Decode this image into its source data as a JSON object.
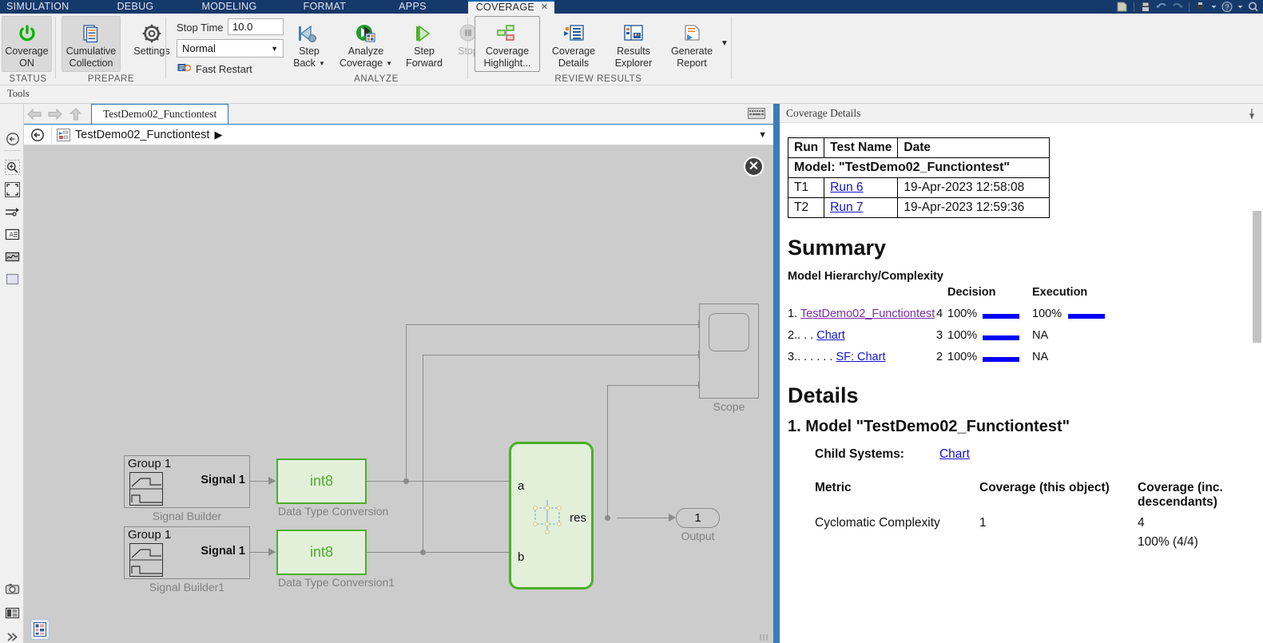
{
  "ribbon": {
    "tabs": [
      {
        "label": "SIMULATION",
        "active": false
      },
      {
        "label": "DEBUG",
        "active": false
      },
      {
        "label": "MODELING",
        "active": false
      },
      {
        "label": "FORMAT",
        "active": false
      },
      {
        "label": "APPS",
        "active": false
      },
      {
        "label": "COVERAGE",
        "active": true
      }
    ],
    "groups": {
      "status": {
        "caption": "STATUS",
        "coverage_toggle": {
          "line1": "Coverage",
          "line2": "ON",
          "icon": "power-icon"
        }
      },
      "prepare": {
        "caption": "PREPARE",
        "cumulative": {
          "line1": "Cumulative",
          "line2": "Collection",
          "icon": "documents-icon"
        },
        "settings": {
          "label": "Settings",
          "icon": "gear-icon"
        }
      },
      "analyze": {
        "caption": "ANALYZE",
        "stop_time_label": "Stop Time",
        "stop_time_value": "10.0",
        "sim_mode_value": "Normal",
        "fast_restart_label": "Fast Restart",
        "step_back": {
          "line1": "Step",
          "line2": "Back",
          "icon": "step-back-icon"
        },
        "analyze_coverage": {
          "line1": "Analyze",
          "line2": "Coverage",
          "icon": "run-coverage-icon"
        },
        "step_forward": {
          "line1": "Step",
          "line2": "Forward",
          "icon": "step-forward-icon"
        },
        "stop": {
          "label": "Stop",
          "icon": "stop-icon"
        }
      },
      "review": {
        "caption": "REVIEW RESULTS",
        "coverage_highlight": {
          "line1": "Coverage",
          "line2": "Highlight...",
          "icon": "coverage-highlight-icon"
        },
        "coverage_details": {
          "line1": "Coverage",
          "line2": "Details",
          "icon": "coverage-details-icon"
        },
        "results_explorer": {
          "line1": "Results",
          "line2": "Explorer",
          "icon": "results-explorer-icon"
        },
        "generate_report": {
          "line1": "Generate",
          "line2": "Report",
          "icon": "generate-report-icon"
        }
      }
    }
  },
  "tools_bar": {
    "label": "Tools"
  },
  "editor": {
    "tab_label": "TestDemo02_Functiontest",
    "breadcrumb_label": "TestDemo02_Functiontest"
  },
  "canvas": {
    "blocks": [
      {
        "name": "Signal Builder",
        "group": "Group 1",
        "signal": "Signal 1"
      },
      {
        "name": "Signal Builder1",
        "group": "Group 1",
        "signal": "Signal 1"
      },
      {
        "name": "Data Type Conversion",
        "type_label": "int8"
      },
      {
        "name": "Data Type Conversion1",
        "type_label": "int8"
      },
      {
        "name": "Chart",
        "port_a": "a",
        "port_b": "b",
        "port_res": "res"
      },
      {
        "name": "Output",
        "port_number": "1"
      },
      {
        "name": "Scope"
      }
    ]
  },
  "coverage": {
    "panel_title": "Coverage Details",
    "run_table": {
      "headers": [
        "Run",
        "Test Name",
        "Date"
      ],
      "model_row": "Model: \"TestDemo02_Functiontest\"",
      "rows": [
        {
          "run": "T1",
          "test_name": "Run 6",
          "date": "19-Apr-2023 12:58:08"
        },
        {
          "run": "T2",
          "test_name": "Run 7",
          "date": "19-Apr-2023 12:59:36"
        }
      ]
    },
    "summary": {
      "heading": "Summary",
      "subheading": "Model Hierarchy/Complexity",
      "col_decision": "Decision",
      "col_execution": "Execution",
      "rows": [
        {
          "index": "1.",
          "indent": "",
          "name": "TestDemo02_Functiontest",
          "visited": true,
          "complexity": "4",
          "decision": "100%",
          "decision_bar": 46,
          "execution": "100%",
          "execution_bar": 46
        },
        {
          "index": "2.",
          "indent": ". . . ",
          "name": "Chart",
          "visited": false,
          "complexity": "3",
          "decision": "100%",
          "decision_bar": 46,
          "execution": "NA",
          "execution_bar": 0
        },
        {
          "index": "3.",
          "indent": ". . . . . . ",
          "name": "SF: Chart",
          "visited": false,
          "complexity": "2",
          "decision": "100%",
          "decision_bar": 46,
          "execution": "NA",
          "execution_bar": 0
        }
      ]
    },
    "details": {
      "heading": "Details",
      "item_title": "1. Model \"TestDemo02_Functiontest\"",
      "child_systems_label": "Child Systems:",
      "child_systems_value": "Chart",
      "metric_headers": [
        "Metric",
        "Coverage (this object)",
        "Coverage (inc. descendants)"
      ],
      "metric_rows": [
        {
          "metric": "Cyclomatic Complexity",
          "this_object": "1",
          "descendants_1": "4",
          "descendants_2": "100% (4/4)"
        }
      ]
    }
  },
  "colors": {
    "ribbon_blue": "#16396b",
    "accent_blue": "#0a64b0",
    "coverage_green": "#4caf27",
    "block_fill": "#e2f0da",
    "canvas_gray": "#cccccc",
    "bar_blue": "#0000f5",
    "link_blue": "#1414cc",
    "link_visited": "#7b2fa8",
    "splitter_blue": "#3a7cb8"
  }
}
